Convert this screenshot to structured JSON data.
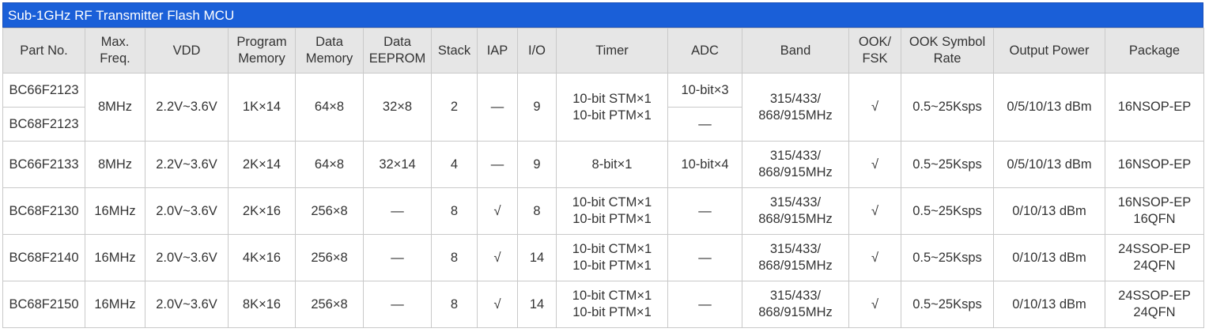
{
  "title": "Sub-1GHz RF Transmitter Flash MCU",
  "headers": [
    [
      "Part No."
    ],
    [
      "Max.",
      "Freq."
    ],
    [
      "VDD"
    ],
    [
      "Program",
      "Memory"
    ],
    [
      "Data",
      "Memory"
    ],
    [
      "Data",
      "EEPROM"
    ],
    [
      "Stack"
    ],
    [
      "IAP"
    ],
    [
      "I/O"
    ],
    [
      "Timer"
    ],
    [
      "ADC"
    ],
    [
      "Band"
    ],
    [
      "OOK/",
      "FSK"
    ],
    [
      "OOK Symbol",
      "Rate"
    ],
    [
      "Output Power"
    ],
    [
      "Package"
    ]
  ],
  "group1": {
    "parts": [
      "BC66F2123",
      "BC68F2123"
    ],
    "freq": "8MHz",
    "vdd": "2.2V~3.6V",
    "program_memory": "1K×14",
    "data_memory": "64×8",
    "eeprom": "32×8",
    "stack": "2",
    "iap": "—",
    "io": "9",
    "timer": [
      "10-bit STM×1",
      "10-bit PTM×1"
    ],
    "adc": [
      "10-bit×3",
      "—"
    ],
    "band": [
      "315/433/",
      "868/915MHz"
    ],
    "ook_fsk": "√",
    "symbol_rate": "0.5~25Ksps",
    "output_power": "0/5/10/13 dBm",
    "package": [
      "16NSOP-EP"
    ]
  },
  "rows": [
    {
      "part": "BC66F2133",
      "freq": "8MHz",
      "vdd": "2.2V~3.6V",
      "program_memory": "2K×14",
      "data_memory": "64×8",
      "eeprom": "32×14",
      "stack": "4",
      "iap": "—",
      "io": "9",
      "timer": [
        "8-bit×1"
      ],
      "adc": "10-bit×4",
      "band": [
        "315/433/",
        "868/915MHz"
      ],
      "ook_fsk": "√",
      "symbol_rate": "0.5~25Ksps",
      "output_power": "0/5/10/13 dBm",
      "package": [
        "16NSOP-EP"
      ]
    },
    {
      "part": "BC68F2130",
      "freq": "16MHz",
      "vdd": "2.0V~3.6V",
      "program_memory": "2K×16",
      "data_memory": "256×8",
      "eeprom": "—",
      "stack": "8",
      "iap": "√",
      "io": "8",
      "timer": [
        "10-bit CTM×1",
        "10-bit PTM×1"
      ],
      "adc": "—",
      "band": [
        "315/433/",
        "868/915MHz"
      ],
      "ook_fsk": "√",
      "symbol_rate": "0.5~25Ksps",
      "output_power": "0/10/13 dBm",
      "package": [
        "16NSOP-EP",
        "16QFN"
      ]
    },
    {
      "part": "BC68F2140",
      "freq": "16MHz",
      "vdd": "2.0V~3.6V",
      "program_memory": "4K×16",
      "data_memory": "256×8",
      "eeprom": "—",
      "stack": "8",
      "iap": "√",
      "io": "14",
      "timer": [
        "10-bit CTM×1",
        "10-bit PTM×1"
      ],
      "adc": "—",
      "band": [
        "315/433/",
        "868/915MHz"
      ],
      "ook_fsk": "√",
      "symbol_rate": "0.5~25Ksps",
      "output_power": "0/10/13 dBm",
      "package": [
        "24SSOP-EP",
        "24QFN"
      ]
    },
    {
      "part": "BC68F2150",
      "freq": "16MHz",
      "vdd": "2.0V~3.6V",
      "program_memory": "8K×16",
      "data_memory": "256×8",
      "eeprom": "—",
      "stack": "8",
      "iap": "√",
      "io": "14",
      "timer": [
        "10-bit CTM×1",
        "10-bit PTM×1"
      ],
      "adc": "—",
      "band": [
        "315/433/",
        "868/915MHz"
      ],
      "ook_fsk": "√",
      "symbol_rate": "0.5~25Ksps",
      "output_power": "0/10/13 dBm",
      "package": [
        "24SSOP-EP",
        "24QFN"
      ]
    }
  ]
}
